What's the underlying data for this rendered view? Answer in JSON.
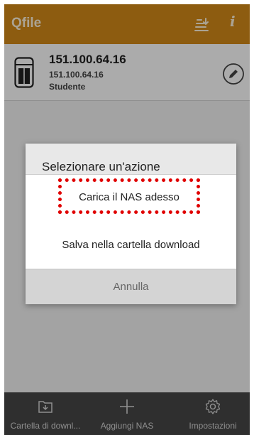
{
  "app": {
    "title": "Qfile",
    "sort_icon": "sort-icon",
    "info_icon": "info-icon",
    "info_glyph": "i"
  },
  "nas": {
    "name": "151.100.64.16",
    "ip": "151.100.64.16",
    "user": "Studente",
    "device_icon": "nas-device-icon",
    "edit_icon": "edit-icon"
  },
  "dialog": {
    "title": "Selezionare un'azione",
    "options": [
      "Carica il NAS adesso",
      "Salva nella cartella download"
    ],
    "cancel": "Annulla",
    "highlight_color": "#e00000"
  },
  "tabs": [
    {
      "label": "Cartella di downl...",
      "icon": "download-folder-icon"
    },
    {
      "label": "Aggiungi NAS",
      "icon": "plus-icon"
    },
    {
      "label": "Impostazioni",
      "icon": "gear-icon"
    }
  ],
  "colors": {
    "accent": "#d28a19",
    "bottom_bar": "#2f2f2f"
  }
}
